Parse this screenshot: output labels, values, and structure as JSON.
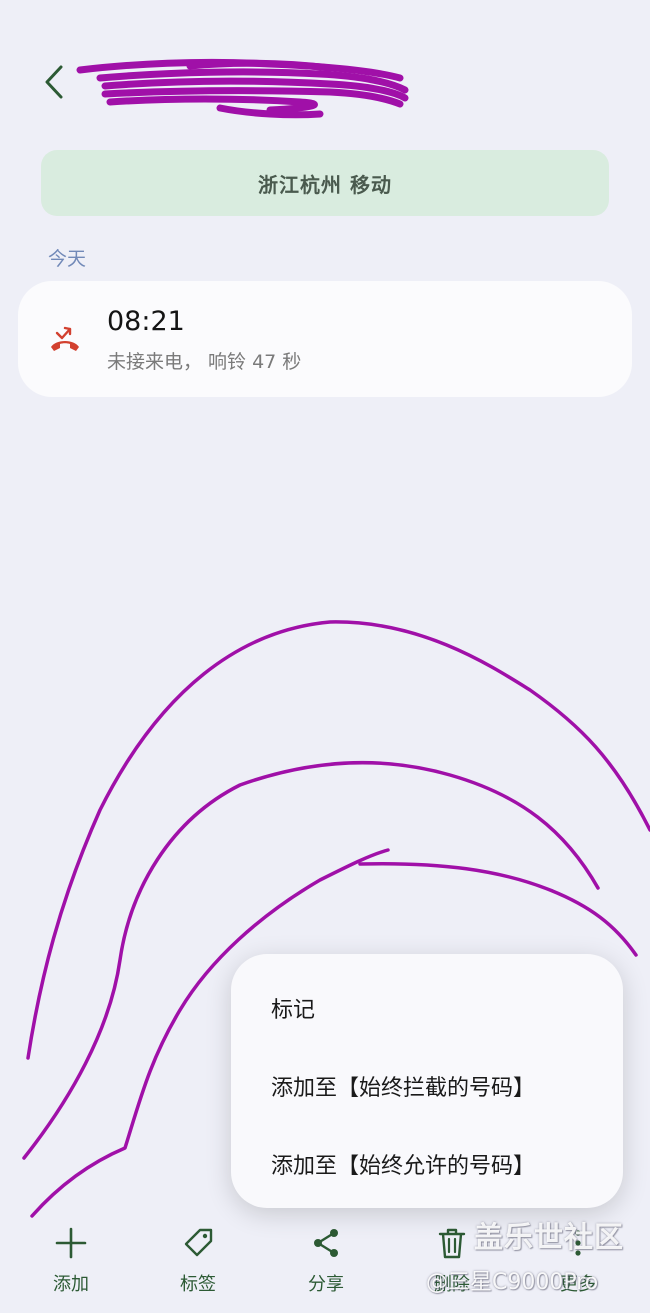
{
  "header": {
    "back_icon": "chevron-left-icon",
    "contact_name_redacted": true
  },
  "location": {
    "text": "浙江杭州 移动"
  },
  "section": {
    "today_label": "今天"
  },
  "call_log": [
    {
      "icon": "missed-call-icon",
      "time": "08:21",
      "detail": "未接来电， 响铃 47 秒"
    }
  ],
  "popup_menu": {
    "items": [
      {
        "label": "标记"
      },
      {
        "label": "添加至【始终拦截的号码】"
      },
      {
        "label": "添加至【始终允许的号码】"
      }
    ]
  },
  "toolbar": {
    "items": [
      {
        "label": "添加",
        "icon": "plus-icon"
      },
      {
        "label": "标签",
        "icon": "tag-icon"
      },
      {
        "label": "分享",
        "icon": "share-icon"
      },
      {
        "label": "删除",
        "icon": "trash-icon"
      },
      {
        "label": "更多",
        "icon": "more-icon"
      }
    ]
  },
  "watermark": {
    "main": "盖乐世社区",
    "sub": "@三星C9000Pro"
  },
  "colors": {
    "background": "#eeeff7",
    "accent_green": "#2c5a34",
    "banner_bg": "#d9ecdf",
    "missed_red": "#d2402f",
    "scribble": "#a010a8",
    "section_label": "#7189b8"
  }
}
